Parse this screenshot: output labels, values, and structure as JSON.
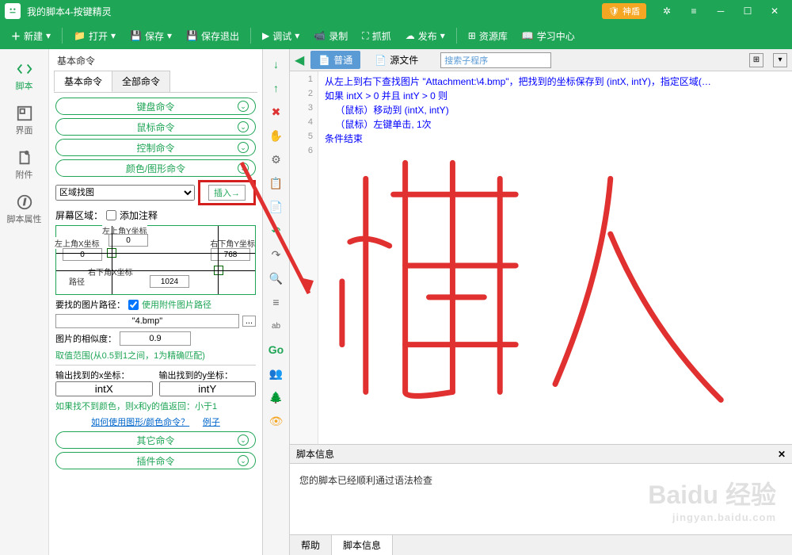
{
  "titlebar": {
    "title": "我的脚本4-按键精灵",
    "shield": "神盾"
  },
  "menubar": {
    "new": "新建",
    "open": "打开",
    "save": "保存",
    "save_exit": "保存退出",
    "debug": "调试",
    "record": "录制",
    "capture": "抓抓",
    "publish": "发布",
    "resource": "资源库",
    "learn": "学习中心"
  },
  "sidebar": {
    "script": "脚本",
    "ui": "界面",
    "attach": "附件",
    "props": "脚本属性"
  },
  "cmd_panel": {
    "title": "基本命令",
    "tab_basic": "基本命令",
    "tab_all": "全部命令",
    "cats": {
      "keyboard": "键盘命令",
      "mouse": "鼠标命令",
      "control": "控制命令",
      "color": "颜色/图形命令",
      "other": "其它命令",
      "plugin": "插件命令"
    },
    "area_find": "区域找图",
    "insert": "插入→",
    "screen_area": "屏幕区域：",
    "add_note": "添加注释",
    "coord": {
      "tl_y_label": "左上角Y坐标",
      "tl_y": "0",
      "tl_x_label": "左上角X坐标",
      "tl_x": "0",
      "br_y_label": "右下角Y坐标",
      "br_y": "768",
      "br_x_label": "右下角X坐标",
      "br_x": "1024",
      "path_label": "路径"
    },
    "img_path_label": "要找的图片路径：",
    "use_attach": "使用附件图片路径",
    "img_path": "\"4.bmp\"",
    "similarity_label": "图片的相似度：",
    "similarity": "0.9",
    "similarity_hint": "取值范围(从0.5到1之间，1为精确匹配)",
    "out_x_label": "输出找到的x坐标：",
    "out_y_label": "输出找到的y坐标：",
    "out_x": "intX",
    "out_y": "intY",
    "notfound_hint": "如果找不到颜色，则x和y的值返回：小于1",
    "howto_link": "如何使用图形/颜色命令？",
    "example_link": "例子"
  },
  "code_tabs": {
    "normal": "普通",
    "source": "源文件",
    "search_placeholder": "搜索子程序"
  },
  "code": {
    "l1": "从左上到右下查找图片 \"Attachment:\\4.bmp\"，把找到的坐标保存到 (intX, intY)，指定区域(…",
    "l2": "如果 intX > 0 并且 intY > 0 则",
    "l3": "    （鼠标）移动到 (intX, intY)",
    "l4": "    （鼠标）左键单击, 1次",
    "l5": "条件结束"
  },
  "info": {
    "header": "脚本信息",
    "body": "您的脚本已经顺利通过语法检查",
    "tab_help": "帮助",
    "tab_info": "脚本信息"
  },
  "watermark": {
    "main": "Baidu 经验",
    "sub": "jingyan.baidu.com"
  }
}
